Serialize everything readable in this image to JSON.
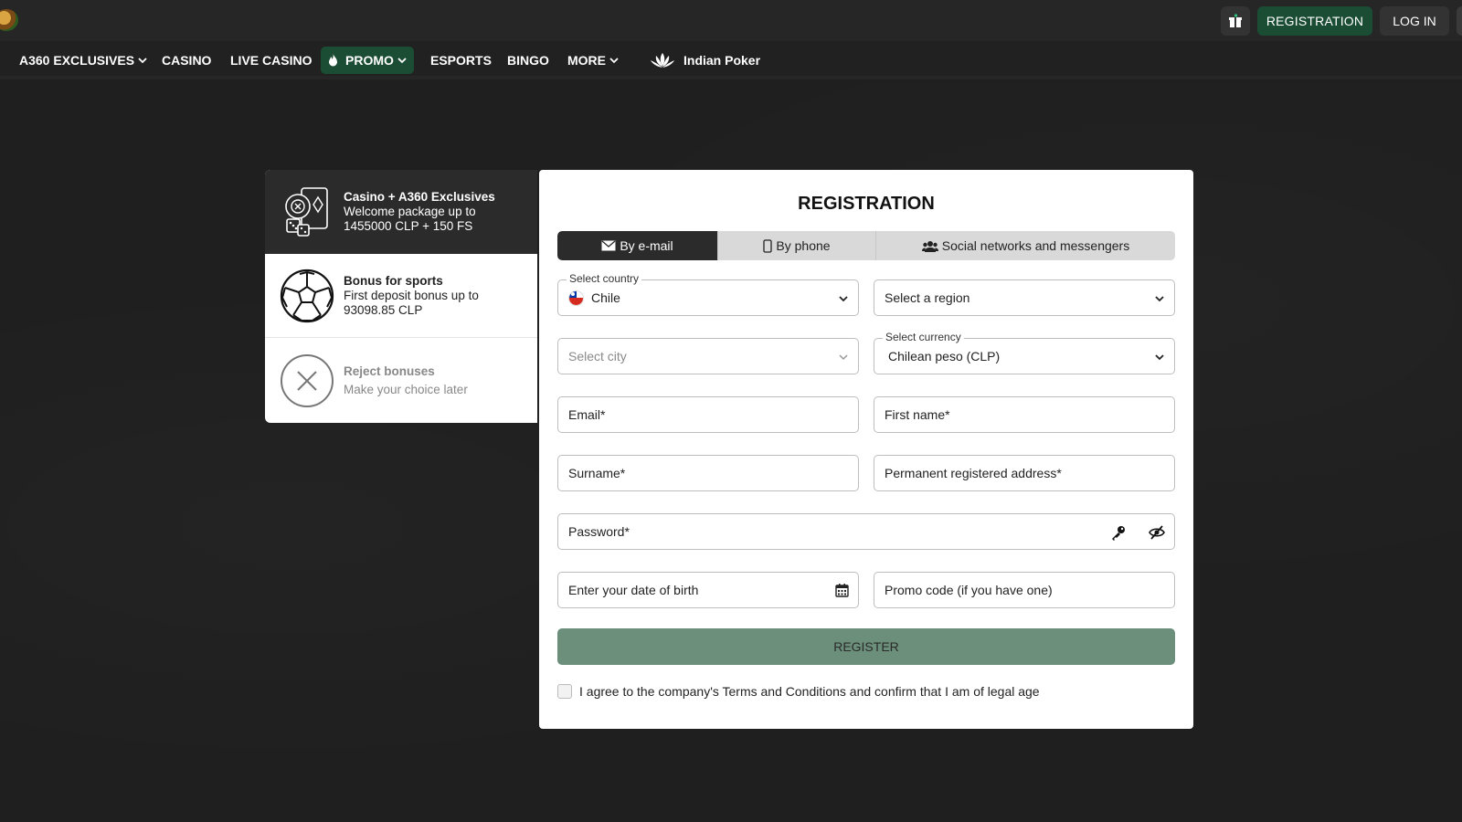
{
  "topbar": {
    "registration_label": "REGISTRATION",
    "login_label": "LOG IN",
    "gift_icon": "gift-icon"
  },
  "nav": {
    "items": [
      {
        "label": "A360 EXCLUSIVES",
        "has_chevron": true
      },
      {
        "label": "CASINO"
      },
      {
        "label": "LIVE CASINO"
      },
      {
        "label": "PROMO",
        "has_chevron": true,
        "icon": "fire-icon",
        "highlighted": true
      },
      {
        "label": "ESPORTS"
      },
      {
        "label": "BINGO"
      },
      {
        "label": "MORE",
        "has_chevron": true
      },
      {
        "label": "Indian Poker",
        "icon": "lotus-icon"
      }
    ]
  },
  "bonuses": [
    {
      "title": "Casino + A360 Exclusives",
      "line1": "Welcome package up to",
      "line2": "1455000 CLP + 150 FS",
      "icon": "casino-chips-icon",
      "selected": true
    },
    {
      "title": "Bonus for sports",
      "line1": "First deposit bonus up to",
      "line2": "93098.85 CLP",
      "icon": "soccer-ball-icon"
    },
    {
      "title": "Reject bonuses",
      "line1": "Make your choice later",
      "line2": "",
      "icon": "close-circle-icon"
    }
  ],
  "registration": {
    "title": "REGISTRATION",
    "tabs": [
      {
        "label": "By e-mail",
        "icon": "envelope-icon",
        "active": true
      },
      {
        "label": "By phone",
        "icon": "phone-icon"
      },
      {
        "label": "Social networks and messengers",
        "icon": "users-icon"
      }
    ],
    "country": {
      "label": "Select country",
      "value": "Chile"
    },
    "region": {
      "placeholder": "Select a region"
    },
    "city": {
      "placeholder": "Select city"
    },
    "currency": {
      "label": "Select currency",
      "value": "Chilean peso (CLP)"
    },
    "email": {
      "placeholder": "Email*"
    },
    "first_name": {
      "placeholder": "First name*"
    },
    "surname": {
      "placeholder": "Surname*"
    },
    "address": {
      "placeholder": "Permanent registered address*"
    },
    "password": {
      "placeholder": "Password*"
    },
    "dob": {
      "placeholder": "Enter your date of birth"
    },
    "promo": {
      "placeholder": "Promo code (if you have one)"
    },
    "register_label": "REGISTER",
    "agree_text": "I agree to the company's Terms and Conditions and confirm that I am of legal age"
  }
}
